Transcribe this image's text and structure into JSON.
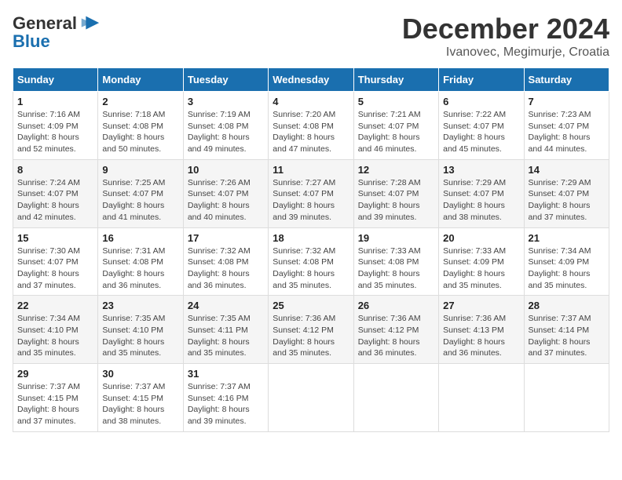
{
  "header": {
    "logo": {
      "general": "General",
      "blue": "Blue"
    },
    "title": "December 2024",
    "location": "Ivanovec, Megimurje, Croatia"
  },
  "days_of_week": [
    "Sunday",
    "Monday",
    "Tuesday",
    "Wednesday",
    "Thursday",
    "Friday",
    "Saturday"
  ],
  "weeks": [
    [
      {
        "day": "1",
        "sunrise": "7:16 AM",
        "sunset": "4:09 PM",
        "daylight": "8 hours and 52 minutes."
      },
      {
        "day": "2",
        "sunrise": "7:18 AM",
        "sunset": "4:08 PM",
        "daylight": "8 hours and 50 minutes."
      },
      {
        "day": "3",
        "sunrise": "7:19 AM",
        "sunset": "4:08 PM",
        "daylight": "8 hours and 49 minutes."
      },
      {
        "day": "4",
        "sunrise": "7:20 AM",
        "sunset": "4:08 PM",
        "daylight": "8 hours and 47 minutes."
      },
      {
        "day": "5",
        "sunrise": "7:21 AM",
        "sunset": "4:07 PM",
        "daylight": "8 hours and 46 minutes."
      },
      {
        "day": "6",
        "sunrise": "7:22 AM",
        "sunset": "4:07 PM",
        "daylight": "8 hours and 45 minutes."
      },
      {
        "day": "7",
        "sunrise": "7:23 AM",
        "sunset": "4:07 PM",
        "daylight": "8 hours and 44 minutes."
      }
    ],
    [
      {
        "day": "8",
        "sunrise": "7:24 AM",
        "sunset": "4:07 PM",
        "daylight": "8 hours and 42 minutes."
      },
      {
        "day": "9",
        "sunrise": "7:25 AM",
        "sunset": "4:07 PM",
        "daylight": "8 hours and 41 minutes."
      },
      {
        "day": "10",
        "sunrise": "7:26 AM",
        "sunset": "4:07 PM",
        "daylight": "8 hours and 40 minutes."
      },
      {
        "day": "11",
        "sunrise": "7:27 AM",
        "sunset": "4:07 PM",
        "daylight": "8 hours and 39 minutes."
      },
      {
        "day": "12",
        "sunrise": "7:28 AM",
        "sunset": "4:07 PM",
        "daylight": "8 hours and 39 minutes."
      },
      {
        "day": "13",
        "sunrise": "7:29 AM",
        "sunset": "4:07 PM",
        "daylight": "8 hours and 38 minutes."
      },
      {
        "day": "14",
        "sunrise": "7:29 AM",
        "sunset": "4:07 PM",
        "daylight": "8 hours and 37 minutes."
      }
    ],
    [
      {
        "day": "15",
        "sunrise": "7:30 AM",
        "sunset": "4:07 PM",
        "daylight": "8 hours and 37 minutes."
      },
      {
        "day": "16",
        "sunrise": "7:31 AM",
        "sunset": "4:08 PM",
        "daylight": "8 hours and 36 minutes."
      },
      {
        "day": "17",
        "sunrise": "7:32 AM",
        "sunset": "4:08 PM",
        "daylight": "8 hours and 36 minutes."
      },
      {
        "day": "18",
        "sunrise": "7:32 AM",
        "sunset": "4:08 PM",
        "daylight": "8 hours and 35 minutes."
      },
      {
        "day": "19",
        "sunrise": "7:33 AM",
        "sunset": "4:08 PM",
        "daylight": "8 hours and 35 minutes."
      },
      {
        "day": "20",
        "sunrise": "7:33 AM",
        "sunset": "4:09 PM",
        "daylight": "8 hours and 35 minutes."
      },
      {
        "day": "21",
        "sunrise": "7:34 AM",
        "sunset": "4:09 PM",
        "daylight": "8 hours and 35 minutes."
      }
    ],
    [
      {
        "day": "22",
        "sunrise": "7:34 AM",
        "sunset": "4:10 PM",
        "daylight": "8 hours and 35 minutes."
      },
      {
        "day": "23",
        "sunrise": "7:35 AM",
        "sunset": "4:10 PM",
        "daylight": "8 hours and 35 minutes."
      },
      {
        "day": "24",
        "sunrise": "7:35 AM",
        "sunset": "4:11 PM",
        "daylight": "8 hours and 35 minutes."
      },
      {
        "day": "25",
        "sunrise": "7:36 AM",
        "sunset": "4:12 PM",
        "daylight": "8 hours and 35 minutes."
      },
      {
        "day": "26",
        "sunrise": "7:36 AM",
        "sunset": "4:12 PM",
        "daylight": "8 hours and 36 minutes."
      },
      {
        "day": "27",
        "sunrise": "7:36 AM",
        "sunset": "4:13 PM",
        "daylight": "8 hours and 36 minutes."
      },
      {
        "day": "28",
        "sunrise": "7:37 AM",
        "sunset": "4:14 PM",
        "daylight": "8 hours and 37 minutes."
      }
    ],
    [
      {
        "day": "29",
        "sunrise": "7:37 AM",
        "sunset": "4:15 PM",
        "daylight": "8 hours and 37 minutes."
      },
      {
        "day": "30",
        "sunrise": "7:37 AM",
        "sunset": "4:15 PM",
        "daylight": "8 hours and 38 minutes."
      },
      {
        "day": "31",
        "sunrise": "7:37 AM",
        "sunset": "4:16 PM",
        "daylight": "8 hours and 39 minutes."
      },
      null,
      null,
      null,
      null
    ]
  ],
  "labels": {
    "sunrise": "Sunrise:",
    "sunset": "Sunset:",
    "daylight": "Daylight:"
  }
}
